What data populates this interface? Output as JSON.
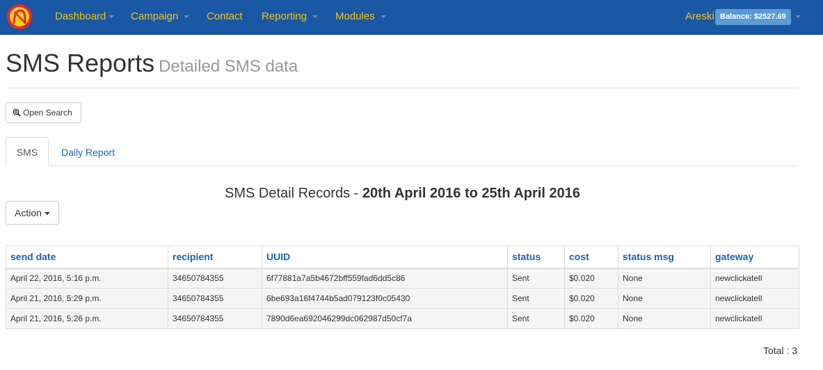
{
  "nav": {
    "items": [
      {
        "label": "Dashboard",
        "has_caret": true
      },
      {
        "label": "Campaign",
        "has_caret": true
      },
      {
        "label": "Contact",
        "has_caret": false
      },
      {
        "label": "Reporting",
        "has_caret": true
      },
      {
        "label": "Modules",
        "has_caret": true
      }
    ],
    "user": "Areski",
    "balance": "Balance: $2527.69",
    "logo_icon": "newfies-logo-icon"
  },
  "header": {
    "title": "SMS Reports",
    "subtitle": "Detailed SMS data"
  },
  "toolbar": {
    "open_search_label": "Open Search",
    "open_search_icon": "zoom-in-icon",
    "action_label": "Action"
  },
  "tabs": [
    {
      "label": "SMS",
      "active": true
    },
    {
      "label": "Daily Report",
      "active": false
    }
  ],
  "report": {
    "title_prefix": "SMS Detail Records - ",
    "title_range": "20th April 2016 to 25th April 2016"
  },
  "table": {
    "columns": [
      "send date",
      "recipient",
      "UUID",
      "status",
      "cost",
      "status msg",
      "gateway"
    ],
    "rows": [
      [
        "April 22, 2016, 5:16 p.m.",
        "34650784355",
        "6f77881a7a5b4672bff559fad6dd5c86",
        "Sent",
        "$0.020",
        "None",
        "newclickatell"
      ],
      [
        "April 21, 2016, 5:29 p.m.",
        "34650784355",
        "6be693a16f4744b5ad079123f0c05430",
        "Sent",
        "$0.020",
        "None",
        "newclickatell"
      ],
      [
        "April 21, 2016, 5:26 p.m.",
        "34650784355",
        "7890d6ea692046299dc062987d50cf7a",
        "Sent",
        "$0.020",
        "None",
        "newclickatell"
      ]
    ]
  },
  "footer": {
    "total": "Total : 3"
  },
  "colors": {
    "navbar": "#1a57a5",
    "nav_text": "#f0c419",
    "link": "#1a63b0",
    "balance_badge": "#5b9bd5"
  }
}
